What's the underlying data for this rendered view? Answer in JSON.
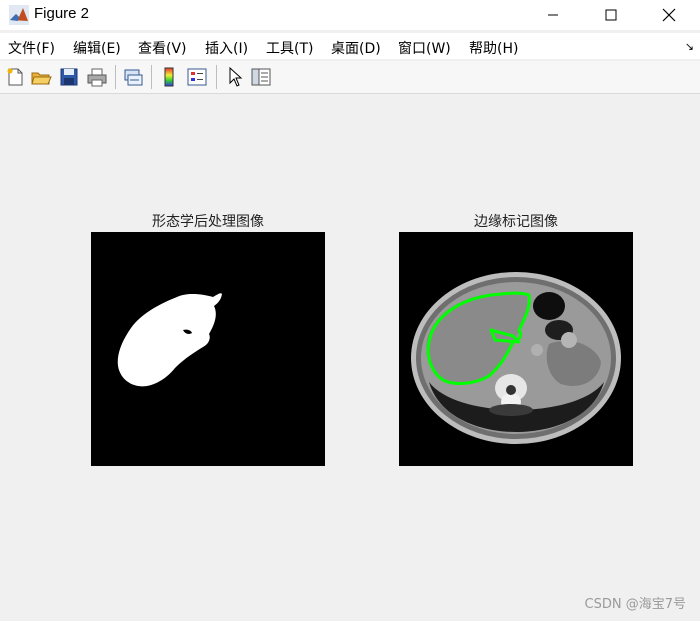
{
  "window": {
    "title": "Figure 2",
    "icon": "matlab-icon",
    "controls": [
      "minimize-icon",
      "maximize-icon",
      "close-icon"
    ]
  },
  "menu": {
    "items": [
      {
        "label": "文件(F)"
      },
      {
        "label": "编辑(E)"
      },
      {
        "label": "查看(V)"
      },
      {
        "label": "插入(I)"
      },
      {
        "label": "工具(T)"
      },
      {
        "label": "桌面(D)"
      },
      {
        "label": "窗口(W)"
      },
      {
        "label": "帮助(H)"
      }
    ],
    "overflow_icon": "dock-arrow-icon"
  },
  "toolbar": {
    "tools": [
      "new-figure-icon",
      "open-icon",
      "save-icon",
      "print-icon",
      "link-icon",
      "colorbar-icon",
      "legend-icon",
      "pointer-icon",
      "property-editor-icon"
    ]
  },
  "figures": [
    {
      "title": "形态学后处理图像"
    },
    {
      "title": "边缘标记图像"
    }
  ],
  "colors": {
    "edge_contour": "#00ff00",
    "background": "#f0f0f0"
  },
  "watermark": "CSDN @海宝7号"
}
